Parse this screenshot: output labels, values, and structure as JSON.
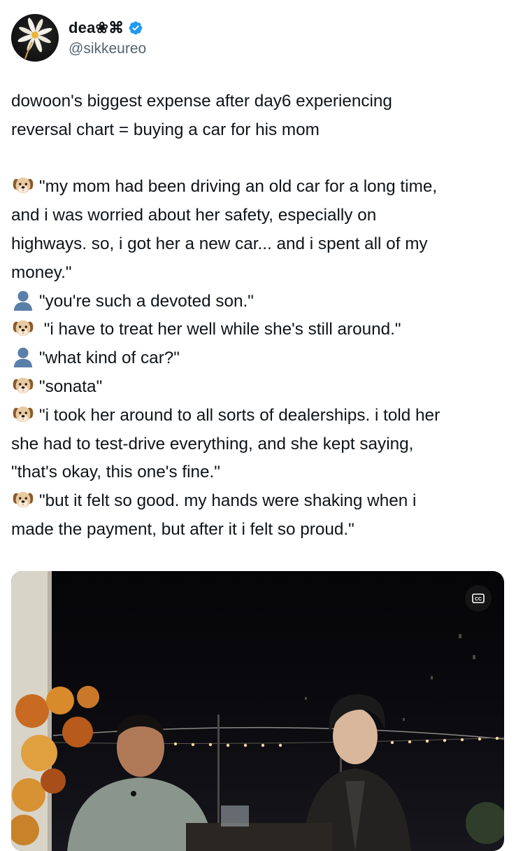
{
  "author": {
    "display_name": "dea❀⌘",
    "handle": "@sikkeureo",
    "verified": true,
    "avatar_icon": "daisy-flower-avatar"
  },
  "tweet": {
    "lines": [
      {
        "icon": null,
        "text": "dowoon's biggest expense after day6 experiencing"
      },
      {
        "icon": null,
        "text": "reversal chart = buying a car for his mom"
      },
      {
        "icon": null,
        "text": ""
      },
      {
        "icon": "dog-face",
        "text": "\"my mom had been driving an old car for a long time,"
      },
      {
        "icon": null,
        "text": "and i was worried about her safety, especially on"
      },
      {
        "icon": null,
        "text": "highways. so, i got her a new car... and i spent all of my"
      },
      {
        "icon": null,
        "text": "money.\""
      },
      {
        "icon": "bust-silhouette",
        "text": "\"you're such a devoted son.\""
      },
      {
        "icon": "dog-face",
        "text": " \"i have to treat her well while she's still around.\""
      },
      {
        "icon": "bust-silhouette",
        "text": "\"what kind of car?\""
      },
      {
        "icon": "dog-face",
        "text": "\"sonata\""
      },
      {
        "icon": "dog-face",
        "text": "\"i took her around to all sorts of dealerships. i told her"
      },
      {
        "icon": null,
        "text": "she had to test-drive everything, and she kept saying,"
      },
      {
        "icon": null,
        "text": "\"that's okay, this one's fine.\""
      },
      {
        "icon": "dog-face",
        "text": "\"but it felt so good. my hands were shaking when i"
      },
      {
        "icon": null,
        "text": "made the payment, but after it i felt so proud.\""
      }
    ]
  },
  "media": {
    "cc_icon": "closed-captions-icon",
    "scene": "video-frame-rooftop-night-two-men-talking"
  },
  "colors": {
    "text": "#0f1419",
    "handle": "#536471",
    "verified": "#1d9bf0"
  }
}
